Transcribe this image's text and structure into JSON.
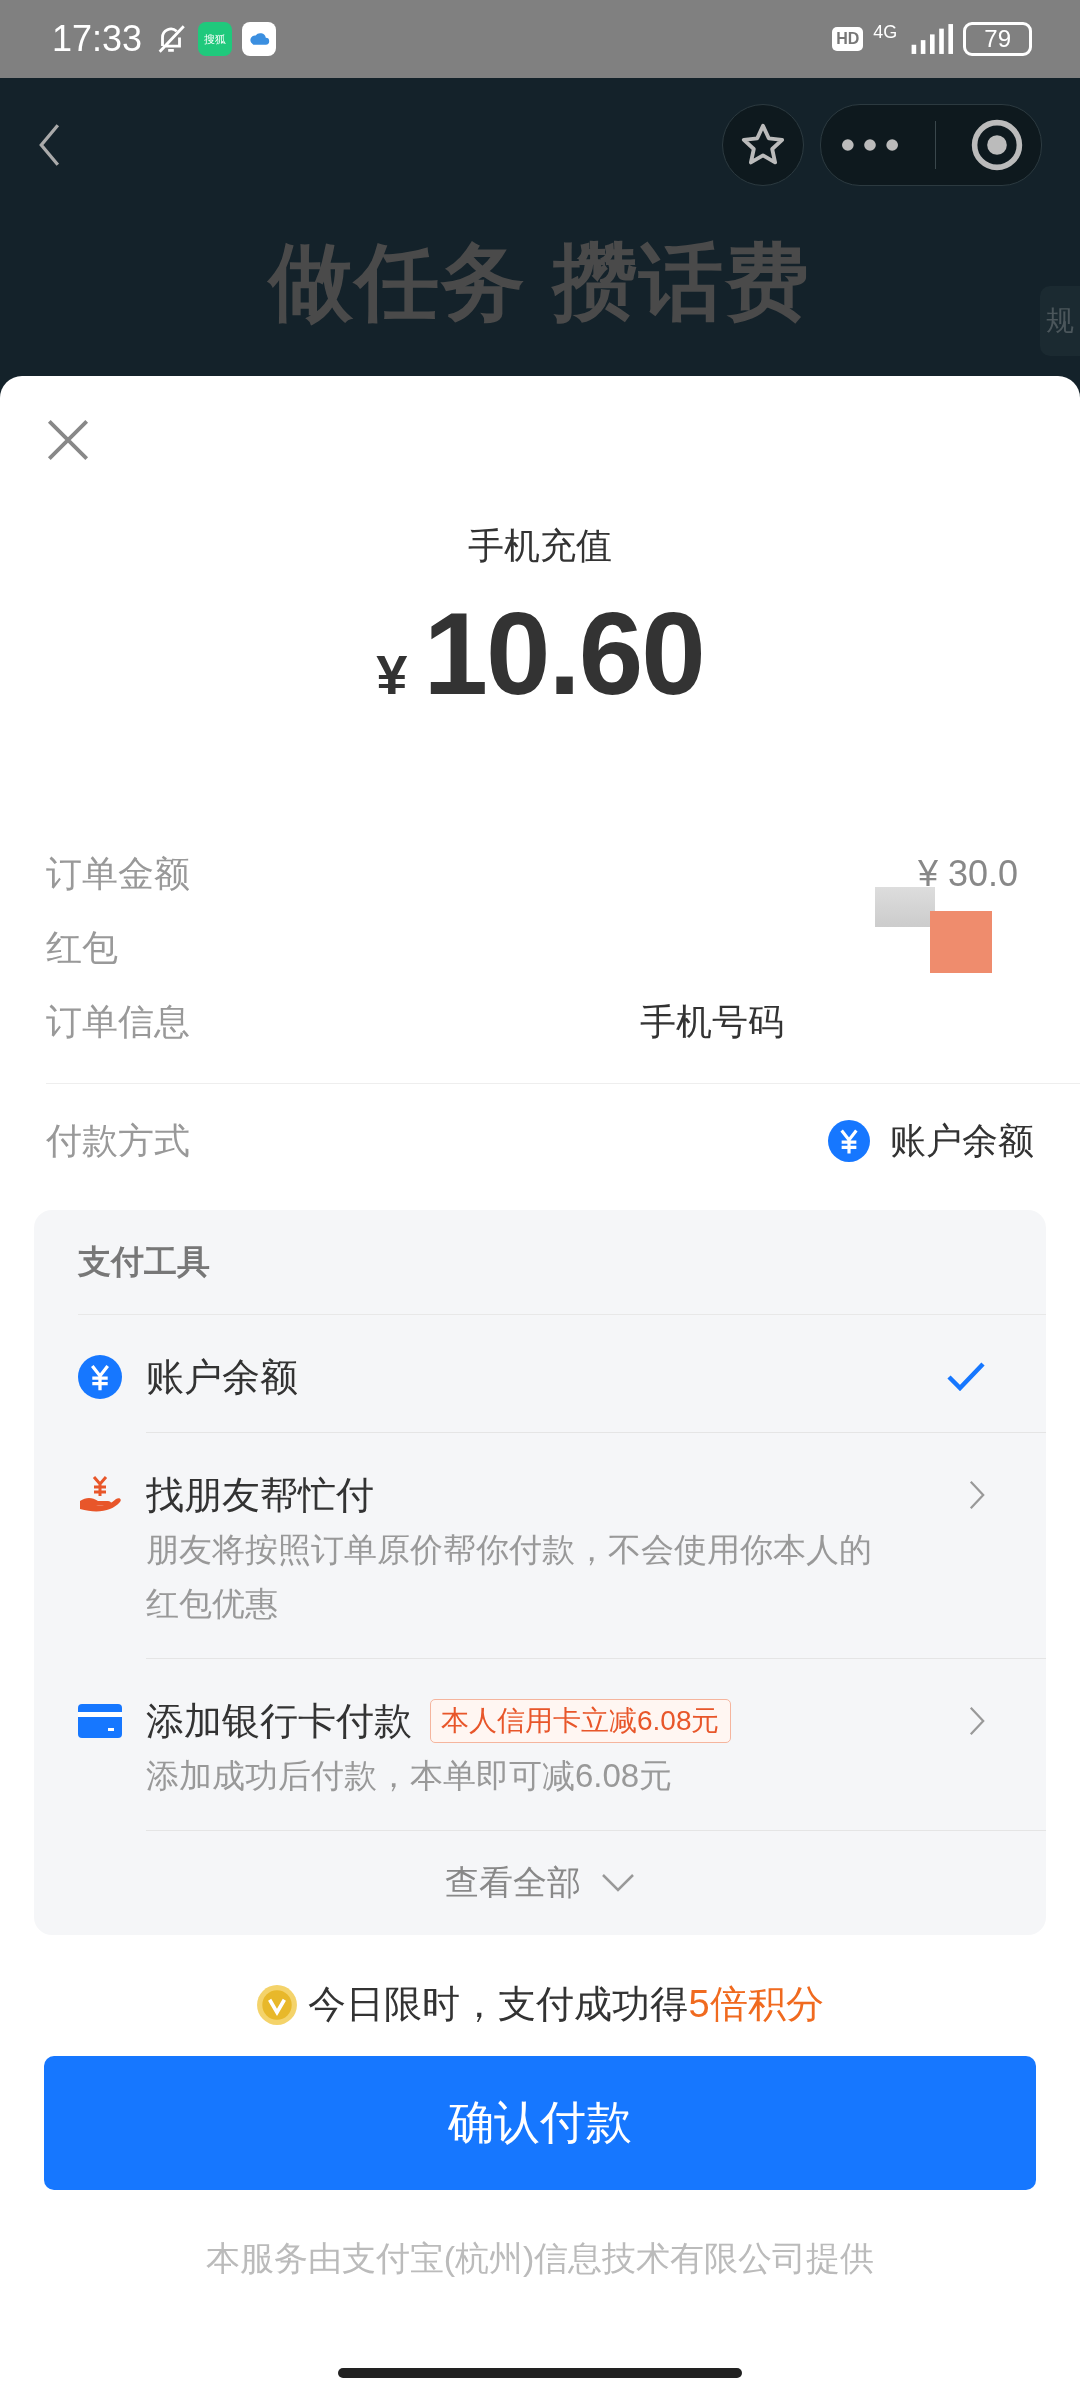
{
  "status_bar": {
    "time": "17:33",
    "app_badges": [
      "搜狐"
    ],
    "hd": "HD",
    "network": "4G",
    "battery": "79"
  },
  "header": {
    "banner": "做任务 攒话费",
    "side_tab": "规"
  },
  "sheet": {
    "title": "手机充值",
    "currency": "¥",
    "amount": "10.60",
    "details": [
      {
        "label": "订单金额",
        "value": "¥ 30.0"
      },
      {
        "label": "红包"
      },
      {
        "label": "订单信息",
        "value": "手机号码"
      }
    ],
    "payment_method": {
      "label": "付款方式",
      "value": "账户余额"
    },
    "tools": {
      "heading": "支付工具",
      "items": [
        {
          "kind": "balance",
          "title": "账户余额",
          "selected": true
        },
        {
          "kind": "friend",
          "title": "找朋友帮忙付",
          "description": "朋友将按照订单原价帮你付款，不会使用你本人的红包优惠",
          "selected": false
        },
        {
          "kind": "card",
          "title": "添加银行卡付款",
          "tag": "本人信用卡立减6.08元",
          "description": "添加成功后付款，本单即可减6.08元",
          "selected": false
        }
      ],
      "more": "查看全部"
    },
    "promo": {
      "text": "今日限时，支付成功得",
      "highlight": "5倍积分"
    },
    "confirm": "确认付款",
    "footer": "本服务由支付宝(杭州)信息技术有限公司提供"
  }
}
